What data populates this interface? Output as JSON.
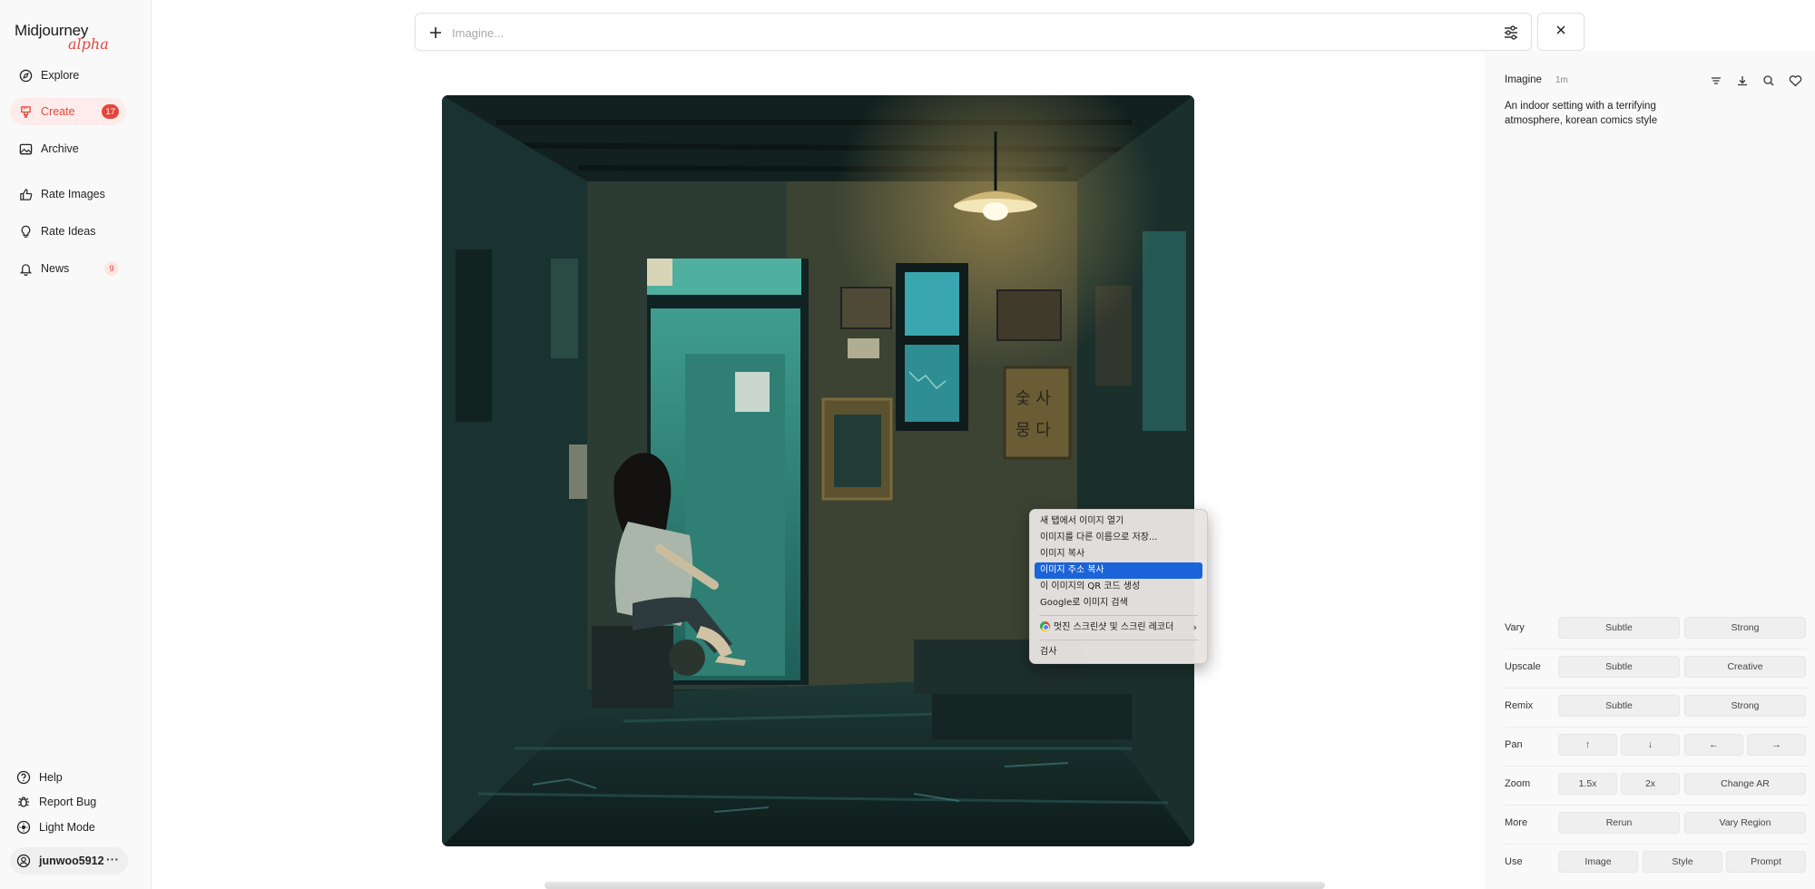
{
  "app": {
    "brand": "Midjourney",
    "brand_sub": "alpha"
  },
  "sidebar": {
    "explore": "Explore",
    "create": "Create",
    "create_badge": "17",
    "archive": "Archive",
    "rate_images": "Rate Images",
    "rate_ideas": "Rate Ideas",
    "news": "News",
    "news_badge": "9",
    "help": "Help",
    "report_bug": "Report Bug",
    "light_mode": "Light Mode",
    "username": "junwoo5912",
    "more": "···"
  },
  "prompt": {
    "placeholder": "Imagine..."
  },
  "panel": {
    "mode": "Imagine",
    "age": "1m",
    "description": "An indoor setting with a terrifying atmosphere, korean comics style",
    "rows": {
      "vary": {
        "label": "Vary",
        "buttons": [
          "Subtle",
          "Strong"
        ]
      },
      "upscale": {
        "label": "Upscale",
        "buttons": [
          "Subtle",
          "Creative"
        ]
      },
      "remix": {
        "label": "Remix",
        "buttons": [
          "Subtle",
          "Strong"
        ]
      },
      "pan": {
        "label": "Pan",
        "buttons": [
          "↑",
          "↓",
          "←",
          "→"
        ]
      },
      "zoom": {
        "label": "Zoom",
        "buttons": [
          "1.5x",
          "2x",
          "Change AR"
        ]
      },
      "more": {
        "label": "More",
        "buttons": [
          "Rerun",
          "Vary Region"
        ]
      },
      "use": {
        "label": "Use",
        "buttons": [
          "Image",
          "Style",
          "Prompt"
        ]
      }
    }
  },
  "context_menu": {
    "items": [
      "새 탭에서 이미지 열기",
      "이미지를 다른 이름으로 저장...",
      "이미지 복사",
      "이미지 주소 복사",
      "이 이미지의 QR 코드 생성",
      "Google로 이미지 검색",
      "멋진 스크린샷 및 스크린 레코더",
      "검사"
    ],
    "highlighted": "이미지 주소 복사"
  },
  "image_sign_text": "숯 사 뭉 다 서",
  "colors": {
    "accent": "#e4463c",
    "menu_highlight": "#1a63d8"
  }
}
